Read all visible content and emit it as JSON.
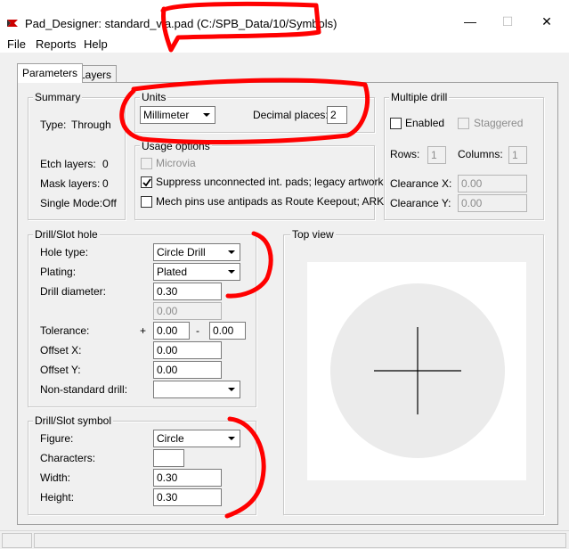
{
  "window": {
    "title": "Pad_Designer: standard_via.pad (C:/SPB_Data/10/Symbols)",
    "minimize_glyph": "—",
    "maximize_glyph": "☐",
    "close_glyph": "✕"
  },
  "menu": [
    "File",
    "Reports",
    "Help"
  ],
  "tabs": [
    "Parameters",
    "Layers"
  ],
  "summary": {
    "label": "Summary",
    "type_label": "Type:",
    "type_value": "Through",
    "etch_label": "Etch layers:",
    "etch_value": "0",
    "mask_label": "Mask layers:",
    "mask_value": "0",
    "single_mode_label": "Single Mode:",
    "single_mode_value": "Off"
  },
  "units": {
    "label": "Units",
    "unit_value": "Millimeter",
    "decimal_label": "Decimal places:",
    "decimal_value": "2"
  },
  "usage": {
    "label": "Usage options",
    "microvia": "Microvia",
    "suppress": "Suppress unconnected int. pads; legacy artwork",
    "mech_pins": "Mech pins use antipads as Route Keepout; ARK"
  },
  "multiple_drill": {
    "label": "Multiple drill",
    "enabled": "Enabled",
    "staggered": "Staggered",
    "rows_label": "Rows:",
    "rows_value": "1",
    "columns_label": "Columns:",
    "columns_value": "1",
    "clearance_x_label": "Clearance X:",
    "clearance_x_value": "0.00",
    "clearance_y_label": "Clearance Y:",
    "clearance_y_value": "0.00"
  },
  "drill_hole": {
    "label": "Drill/Slot hole",
    "hole_type_label": "Hole type:",
    "hole_type_value": "Circle Drill",
    "plating_label": "Plating:",
    "plating_value": "Plated",
    "diameter_label": "Drill diameter:",
    "diameter_value": "0.30",
    "diameter2_value": "0.00",
    "tolerance_label": "Tolerance:",
    "tol_plus": "+",
    "tol_plus_value": "0.00",
    "tol_minus": "-",
    "tol_minus_value": "0.00",
    "offset_x_label": "Offset X:",
    "offset_x_value": "0.00",
    "offset_y_label": "Offset Y:",
    "offset_y_value": "0.00",
    "nonstandard_label": "Non-standard drill:",
    "nonstandard_value": ""
  },
  "drill_symbol": {
    "label": "Drill/Slot symbol",
    "figure_label": "Figure:",
    "figure_value": "Circle",
    "characters_label": "Characters:",
    "characters_value": "",
    "width_label": "Width:",
    "width_value": "0.30",
    "height_label": "Height:",
    "height_value": "0.30"
  },
  "top_view": {
    "label": "Top view"
  },
  "colors": {
    "annotation": "#ff0000",
    "accent_icon": "#cc0000"
  }
}
